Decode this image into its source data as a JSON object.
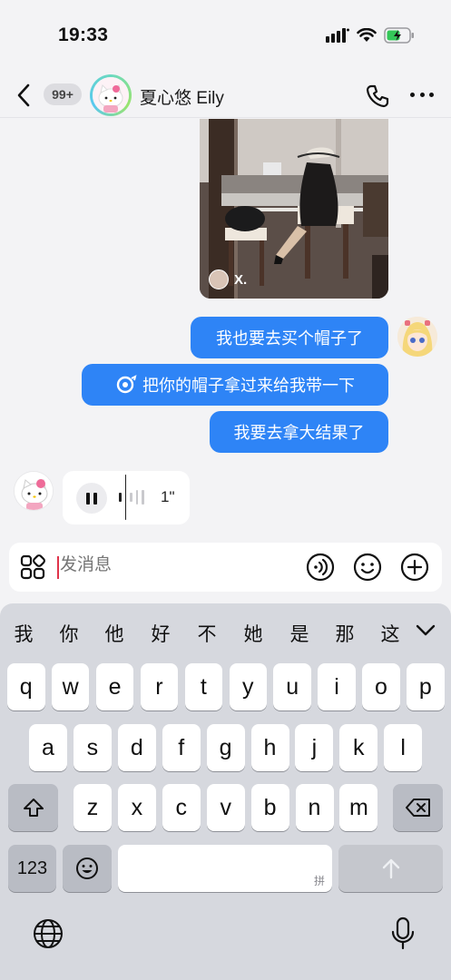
{
  "status_bar": {
    "time": "19:33"
  },
  "header": {
    "unread_count": "99+",
    "contact_name": "夏心悠 Eily"
  },
  "messages": {
    "photo_tag": "X.",
    "out_1": "我也要去买个帽子了",
    "out_2": "把你的帽子拿过来给我带一下",
    "out_3": "我要去拿大结果了",
    "voice_duration": "1\""
  },
  "input": {
    "placeholder": "发消息"
  },
  "keyboard": {
    "candidates": [
      "我",
      "你",
      "他",
      "好",
      "不",
      "她",
      "是",
      "那",
      "这"
    ],
    "row1": [
      "q",
      "w",
      "e",
      "r",
      "t",
      "y",
      "u",
      "i",
      "o",
      "p"
    ],
    "row2": [
      "a",
      "s",
      "d",
      "f",
      "g",
      "h",
      "j",
      "k",
      "l"
    ],
    "row3": [
      "z",
      "x",
      "c",
      "v",
      "b",
      "n",
      "m"
    ],
    "numbers_label": "123",
    "space_hint": "拼"
  },
  "colors": {
    "bubble_out": "#2e84f6",
    "background": "#f3f3f5",
    "keyboard_bg": "#d6d8de",
    "cursor": "#e0334a"
  },
  "icons": [
    "back-arrow-icon",
    "phone-icon",
    "more-dots-icon",
    "apps-grid-icon",
    "voice-icon",
    "emoji-icon",
    "plus-icon",
    "shift-icon",
    "backspace-icon",
    "emoji-key-icon",
    "send-arrow-icon",
    "globe-icon",
    "microphone-icon",
    "signal-icon",
    "wifi-icon",
    "battery-icon"
  ]
}
